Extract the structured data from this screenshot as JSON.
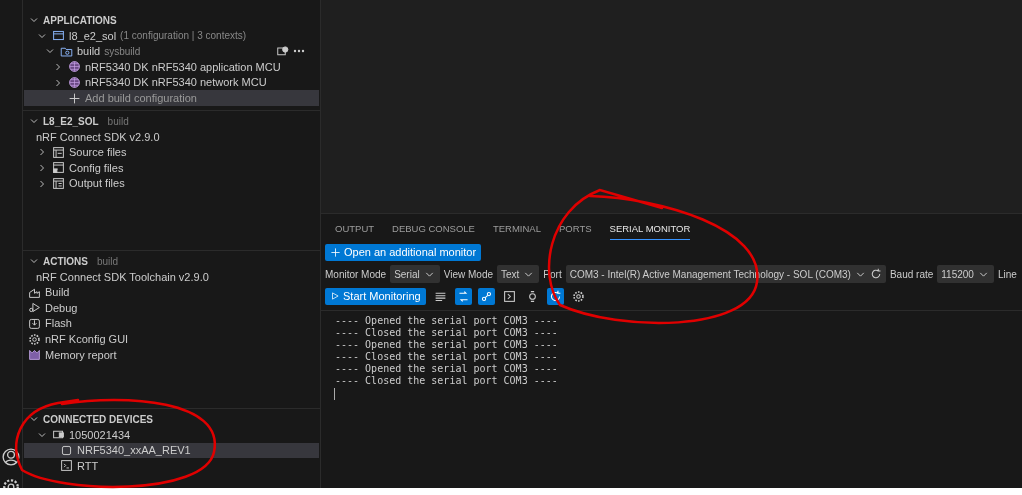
{
  "sidebar": {
    "sections": [
      {
        "title": "APPLICATIONS",
        "expanded": true,
        "items": [
          {
            "kind": "app",
            "label": "l8_e2_sol",
            "detail": "(1 configuration | 3 contexts)",
            "expanded": true,
            "selected": false,
            "children": [
              {
                "kind": "build",
                "label": "build",
                "detail": "sysbuild",
                "expanded": true,
                "selected": false,
                "children": [
                  {
                    "kind": "board",
                    "label": "nRF5340 DK nRF5340 application MCU",
                    "expanded": false,
                    "selected": false
                  },
                  {
                    "kind": "board",
                    "label": "nRF5340 DK nRF5340 network MCU",
                    "expanded": false,
                    "selected": false
                  },
                  {
                    "kind": "add",
                    "label": "Add build configuration",
                    "selected": true
                  }
                ]
              }
            ]
          }
        ]
      },
      {
        "title": "L8_E2_SOL",
        "subtitle": "build",
        "expanded": true,
        "items": [
          {
            "kind": "text",
            "label": "nRF Connect SDK v2.9.0"
          },
          {
            "kind": "source",
            "label": "Source files",
            "expanded": false
          },
          {
            "kind": "config",
            "label": "Config files",
            "expanded": false
          },
          {
            "kind": "output",
            "label": "Output files",
            "expanded": false
          }
        ]
      },
      {
        "title": "ACTIONS",
        "subtitle": "build",
        "expanded": true,
        "items": [
          {
            "kind": "text",
            "label": "nRF Connect SDK Toolchain v2.9.0"
          },
          {
            "kind": "action-build",
            "label": "Build"
          },
          {
            "kind": "debug",
            "label": "Debug"
          },
          {
            "kind": "flash",
            "label": "Flash"
          },
          {
            "kind": "kconfig",
            "label": "nRF Kconfig GUI"
          },
          {
            "kind": "memory",
            "label": "Memory report"
          }
        ]
      },
      {
        "title": "CONNECTED DEVICES",
        "expanded": true,
        "items": [
          {
            "kind": "device",
            "label": "1050021434",
            "expanded": true,
            "selected": false,
            "children": [
              {
                "kind": "chip",
                "label": "NRF5340_xxAA_REV1",
                "selected": true
              },
              {
                "kind": "rtt",
                "label": "RTT",
                "selected": false
              }
            ]
          }
        ]
      }
    ]
  },
  "panel": {
    "tabs": [
      {
        "label": "OUTPUT",
        "selected": false
      },
      {
        "label": "DEBUG CONSOLE",
        "selected": false
      },
      {
        "label": "TERMINAL",
        "selected": false
      },
      {
        "label": "PORTS",
        "selected": false
      },
      {
        "label": "SERIAL MONITOR",
        "selected": true
      }
    ],
    "open_button": "Open an additional monitor",
    "fields": [
      {
        "label": "Monitor Mode",
        "value": "Serial"
      },
      {
        "label": "View Mode",
        "value": "Text"
      },
      {
        "label": "Port",
        "value": "COM3 - Intel(R) Active Management Technology - SOL (COM3)",
        "refresh": true
      },
      {
        "label": "Baud rate",
        "value": "115200"
      },
      {
        "label": "Line"
      }
    ],
    "start_button": "Start Monitoring",
    "toolbar": [
      {
        "kind": "lines",
        "on": false
      },
      {
        "kind": "swap",
        "on": true
      },
      {
        "kind": "link",
        "on": true
      },
      {
        "kind": "terminal",
        "on": false
      },
      {
        "kind": "watch",
        "on": false
      },
      {
        "kind": "sync",
        "on": true
      },
      {
        "kind": "settings",
        "on": false
      }
    ],
    "output": [
      "---- Opened the serial port COM3 ----",
      "---- Closed the serial port COM3 ----",
      "---- Opened the serial port COM3 ----",
      "---- Closed the serial port COM3 ----",
      "---- Opened the serial port COM3 ----",
      "---- Closed the serial port COM3 ----"
    ]
  },
  "annotations": [
    {
      "kind": "freehand-circle"
    },
    {
      "kind": "freehand-circle"
    }
  ]
}
